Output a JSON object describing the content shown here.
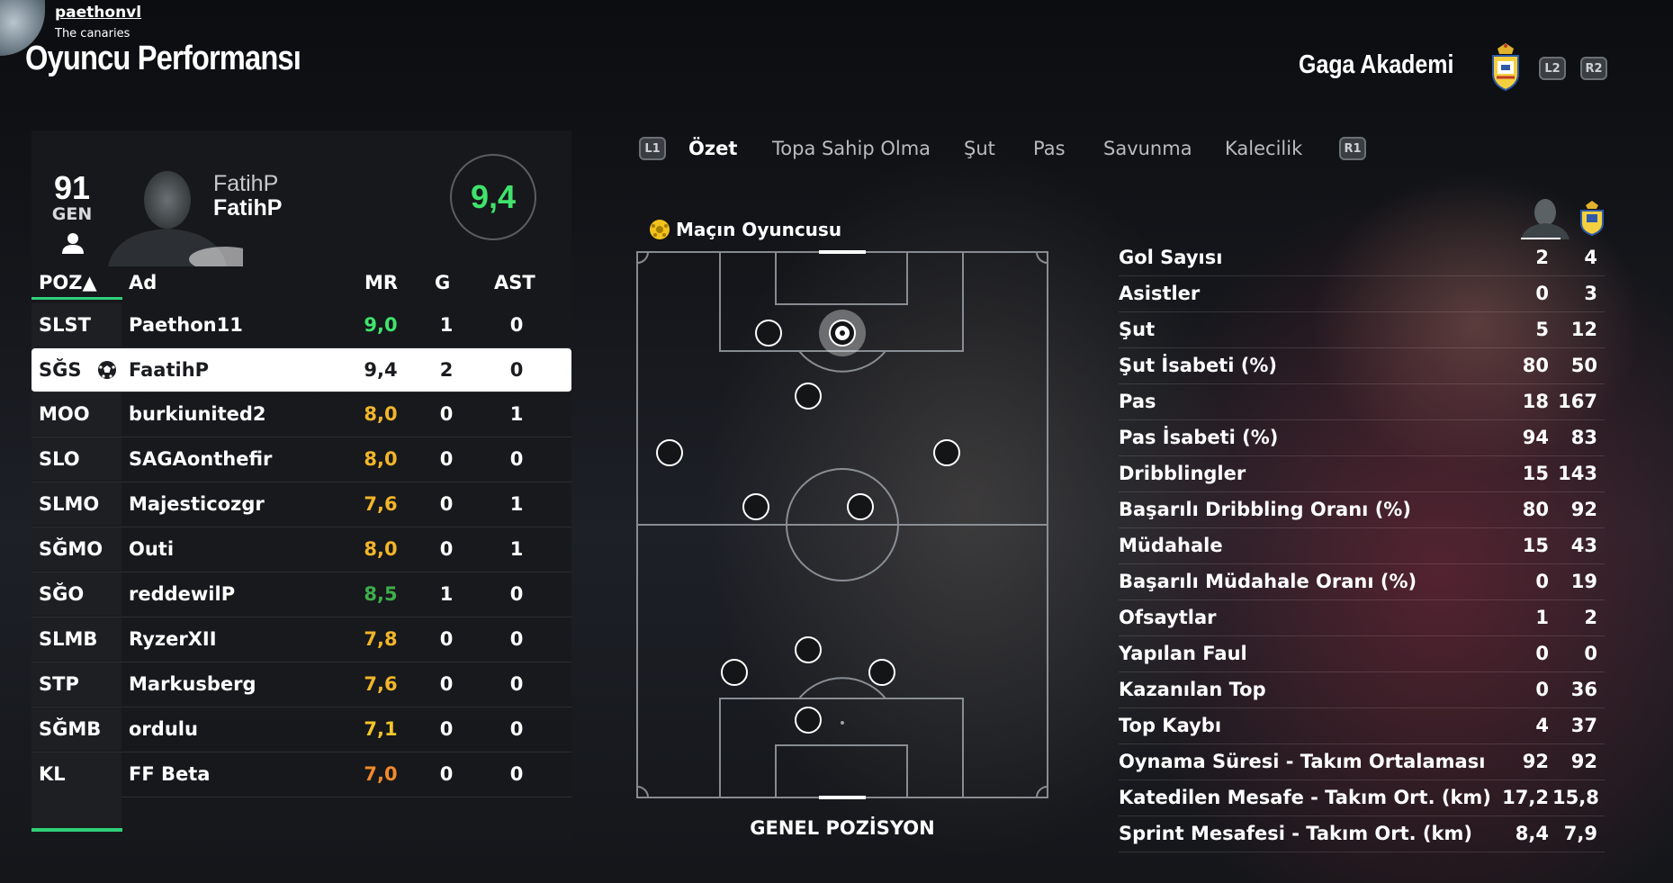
{
  "header": {
    "user_name": "paethonvl",
    "user_team": "The canaries",
    "page_title": "Oyuncu Performansı",
    "club_name": "Gaga Akademi",
    "btn_l2": "L2",
    "btn_r2": "R2"
  },
  "player_card": {
    "overall": "91",
    "overall_label": "GEN",
    "name_line1": "FatihP",
    "name_line2": "FatihP",
    "rating": "9,4"
  },
  "table": {
    "headers": {
      "pos": "POZ▲",
      "name": "Ad",
      "mr": "MR",
      "g": "G",
      "ast": "AST"
    },
    "rows": [
      {
        "pos": "SLST",
        "name": "Paethon11",
        "mr": "9,0",
        "g": "1",
        "ast": "0",
        "mr_color": "#3fe36c"
      },
      {
        "pos": "SĞS",
        "name": "FaatihP",
        "mr": "9,4",
        "g": "2",
        "ast": "0",
        "mr_color": "#1b1c1f",
        "selected": true
      },
      {
        "pos": "MOO",
        "name": "burkiunited2",
        "mr": "8,0",
        "g": "0",
        "ast": "1",
        "mr_color": "#f2b52a"
      },
      {
        "pos": "SLO",
        "name": "SAGAonthefir",
        "mr": "8,0",
        "g": "0",
        "ast": "0",
        "mr_color": "#f2b52a"
      },
      {
        "pos": "SLMO",
        "name": "Majesticozgr",
        "mr": "7,6",
        "g": "0",
        "ast": "1",
        "mr_color": "#f2b52a"
      },
      {
        "pos": "SĞMO",
        "name": "Outi",
        "mr": "8,0",
        "g": "0",
        "ast": "1",
        "mr_color": "#f2b52a"
      },
      {
        "pos": "SĞO",
        "name": "reddewilP",
        "mr": "8,5",
        "g": "1",
        "ast": "0",
        "mr_color": "#3fae4c"
      },
      {
        "pos": "SLMB",
        "name": "RyzerXII",
        "mr": "7,8",
        "g": "0",
        "ast": "0",
        "mr_color": "#f2b52a"
      },
      {
        "pos": "STP",
        "name": "Markusberg",
        "mr": "7,6",
        "g": "0",
        "ast": "0",
        "mr_color": "#f2b52a"
      },
      {
        "pos": "SĞMB",
        "name": "ordulu",
        "mr": "7,1",
        "g": "0",
        "ast": "0",
        "mr_color": "#f2c52a"
      },
      {
        "pos": "KL",
        "name": "FF Beta",
        "mr": "7,0",
        "g": "0",
        "ast": "0",
        "mr_color": "#f08a2a"
      }
    ]
  },
  "tabs": {
    "btn_l1": "L1",
    "btn_r1": "R1",
    "items": [
      "Özet",
      "Topa Sahip Olma",
      "Şut",
      "Pas",
      "Savunma",
      "Kalecilik"
    ],
    "active": "Özet"
  },
  "pitch": {
    "motm_label": "Maçın Oyuncusu",
    "label": "GENEL POZİSYON"
  },
  "stats": [
    {
      "label": "Gol Sayısı",
      "player": "2",
      "team": "4"
    },
    {
      "label": "Asistler",
      "player": "0",
      "team": "3"
    },
    {
      "label": "Şut",
      "player": "5",
      "team": "12"
    },
    {
      "label": "Şut İsabeti (%)",
      "player": "80",
      "team": "50"
    },
    {
      "label": "Pas",
      "player": "18",
      "team": "167"
    },
    {
      "label": "Pas İsabeti (%)",
      "player": "94",
      "team": "83"
    },
    {
      "label": "Dribblingler",
      "player": "15",
      "team": "143"
    },
    {
      "label": "Başarılı Dribbling Oranı (%)",
      "player": "80",
      "team": "92"
    },
    {
      "label": "Müdahale",
      "player": "15",
      "team": "43"
    },
    {
      "label": "Başarılı Müdahale Oranı (%)",
      "player": "0",
      "team": "19"
    },
    {
      "label": "Ofsaytlar",
      "player": "1",
      "team": "2"
    },
    {
      "label": "Yapılan Faul",
      "player": "0",
      "team": "0"
    },
    {
      "label": "Kazanılan Top",
      "player": "0",
      "team": "36"
    },
    {
      "label": "Top Kaybı",
      "player": "4",
      "team": "37"
    },
    {
      "label": "Oynama Süresi - Takım Ortalaması",
      "player": "92",
      "team": "92"
    },
    {
      "label": "Katedilen Mesafe - Takım Ort. (km)",
      "player": "17,2",
      "team": "15,8"
    },
    {
      "label": "Sprint Mesafesi - Takım Ort. (km)",
      "player": "8,4",
      "team": "7,9"
    }
  ],
  "colors": {
    "accent": "#2fd07a",
    "rating_green": "#3fe36c"
  }
}
